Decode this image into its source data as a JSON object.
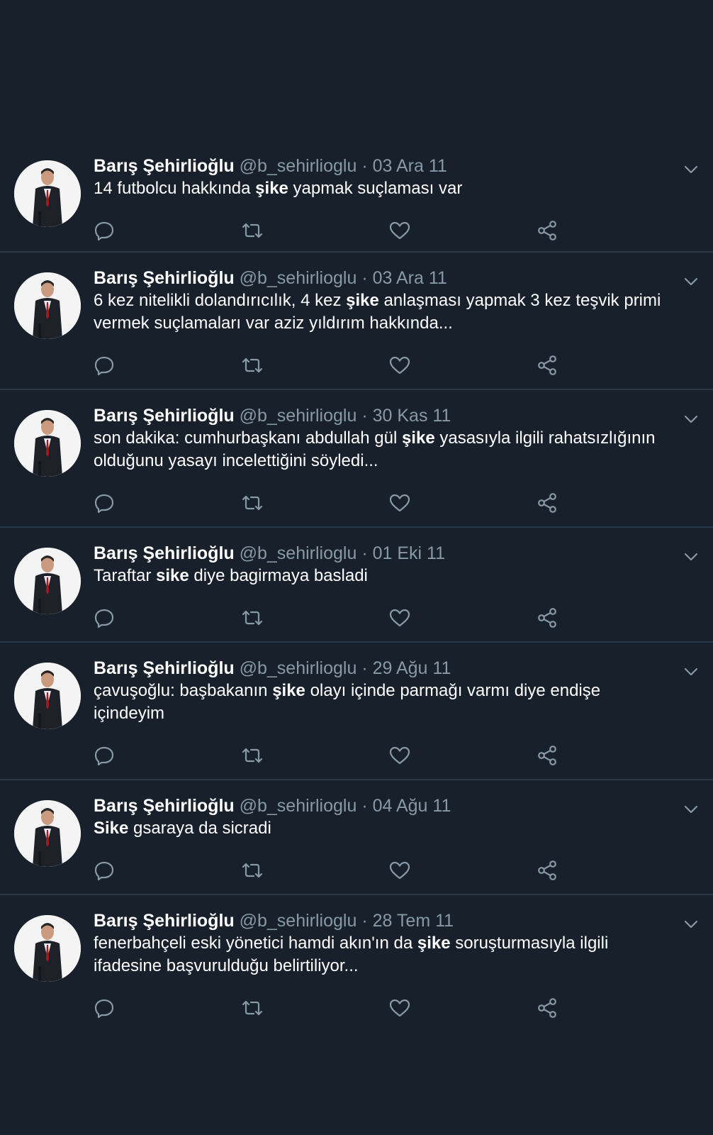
{
  "colors": {
    "background": "#17202b",
    "divider": "#2b3744",
    "secondary_text": "#8899a6",
    "icon": "#8899a6"
  },
  "icons": {
    "reply": "reply-icon",
    "retweet": "retweet-icon",
    "like": "like-icon",
    "share": "share-icon",
    "more": "chevron-down-icon"
  },
  "tweets": [
    {
      "name": "Barış Şehirlioğlu",
      "handle": "@b_sehirlioglu",
      "separator": "·",
      "date": "03 Ara 11",
      "text_before": "14 futbolcu hakkında ",
      "highlight": "şike",
      "text_after": " yapmak suçlaması var"
    },
    {
      "name": "Barış Şehirlioğlu",
      "handle": "@b_sehirlioglu",
      "separator": "·",
      "date": "03 Ara 11",
      "text_before": "6 kez nitelikli dolandırıcılık, 4 kez ",
      "highlight": "şike",
      "text_after": " anlaşması yapmak 3 kez teşvik primi vermek suçlamaları var aziz yıldırım hakkında..."
    },
    {
      "name": "Barış Şehirlioğlu",
      "handle": "@b_sehirlioglu",
      "separator": "·",
      "date": "30 Kas 11",
      "text_before": "son dakika: cumhurbaşkanı abdullah gül ",
      "highlight": "şike",
      "text_after": " yasasıyla ilgili rahatsızlığının olduğunu yasayı incelettiğini söyledi..."
    },
    {
      "name": "Barış Şehirlioğlu",
      "handle": "@b_sehirlioglu",
      "separator": "·",
      "date": "01 Eki 11",
      "text_before": "Taraftar ",
      "highlight": "sike",
      "text_after": " diye bagirmaya basladi"
    },
    {
      "name": "Barış Şehirlioğlu",
      "handle": "@b_sehirlioglu",
      "separator": "·",
      "date": "29 Ağu 11",
      "text_before": "çavuşoğlu: başbakanın ",
      "highlight": "şike",
      "text_after": " olayı içinde parmağı varmı diye endişe içindeyim"
    },
    {
      "name": "Barış Şehirlioğlu",
      "handle": "@b_sehirlioglu",
      "separator": "·",
      "date": "04 Ağu 11",
      "text_before": "",
      "highlight": "Sike",
      "text_after": " gsaraya da sicradi"
    },
    {
      "name": "Barış Şehirlioğlu",
      "handle": "@b_sehirlioglu",
      "separator": "·",
      "date": "28 Tem 11",
      "text_before": "fenerbahçeli eski yönetici hamdi akın'ın da ",
      "highlight": "şike",
      "text_after": " soruşturmasıyla ilgili ifadesine başvurulduğu belirtiliyor..."
    }
  ]
}
